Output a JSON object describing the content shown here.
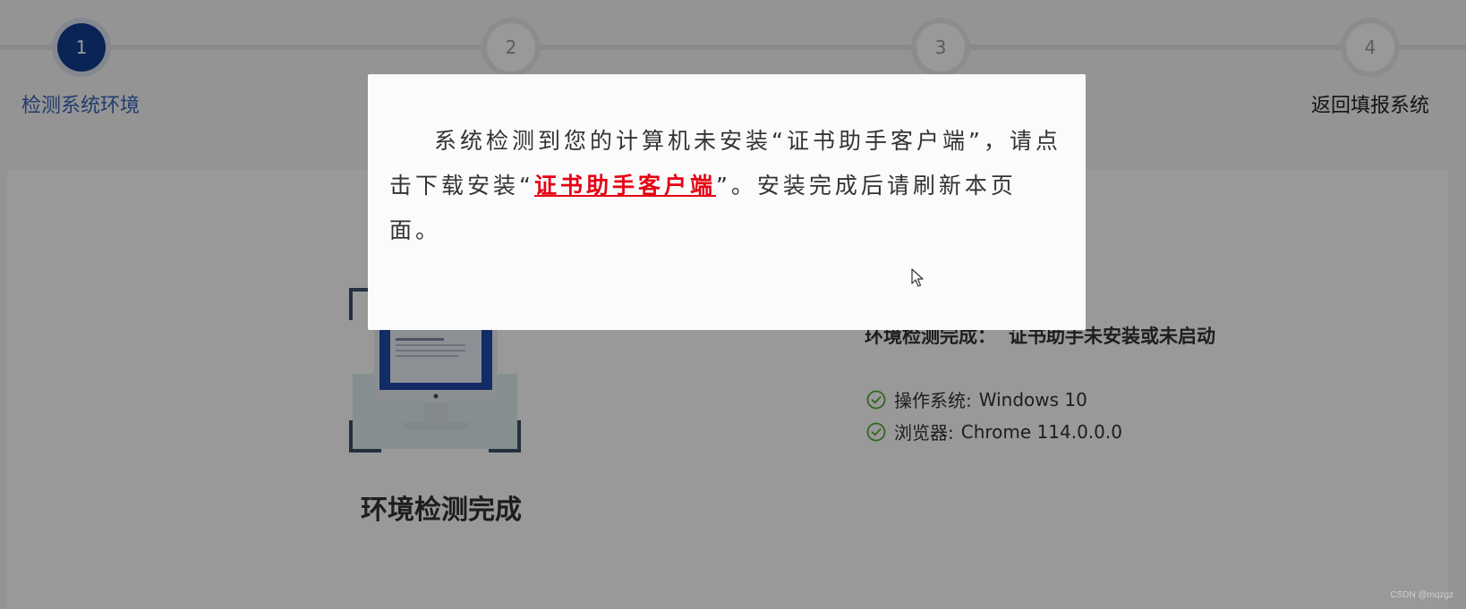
{
  "stepper": {
    "steps": [
      {
        "number": "1",
        "label": "检测系统环境",
        "active": true
      },
      {
        "number": "2",
        "label": "",
        "active": false
      },
      {
        "number": "3",
        "label": "",
        "active": false
      },
      {
        "number": "4",
        "label": "返回填报系统",
        "active": false
      }
    ]
  },
  "main": {
    "env_title": "环境检测完成",
    "result_label": "环境检测完成：",
    "result_value": "证书助手未安装或未启动",
    "info": [
      {
        "label": "操作系统:",
        "value": "Windows 10",
        "icon": "check-circle-icon"
      },
      {
        "label": "浏览器:",
        "value": "Chrome 114.0.0.0",
        "icon": "check-circle-icon"
      }
    ]
  },
  "dialog": {
    "text_before": "系统检测到您的计算机未安装“证书助手客户端”，请点击下载安装“",
    "link_text": "证书助手客户端",
    "text_after": "”。安装完成后请刷新本页面。"
  },
  "watermark": "CSDN @mqzgz",
  "colors": {
    "primary": "#133d8f",
    "active_label": "#3b63b8",
    "link": "#e60012",
    "success": "#52a83c"
  }
}
